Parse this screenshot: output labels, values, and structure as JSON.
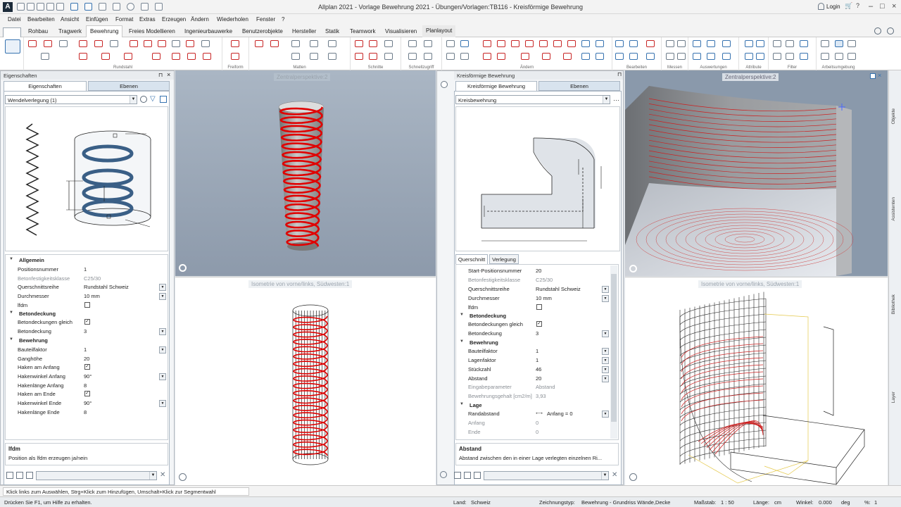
{
  "app": {
    "title": "Allplan 2021 - Vorlage Bewehrung 2021 - Übungen/Vorlagen:TB116 - Kreisförmige Bewehrung",
    "login": "Login",
    "logo": "A"
  },
  "menu": [
    "Datei",
    "Bearbeiten",
    "Ansicht",
    "Einfügen",
    "Format",
    "Extras",
    "Erzeugen",
    "Ändern",
    "Wiederholen",
    "Fenster",
    "?"
  ],
  "ribbon_tabs": [
    "Rohbau",
    "Tragwerk",
    "Bewehrung",
    "Freies Modellieren",
    "Ingenieurbauwerke",
    "Benutzerobjekte",
    "Hersteller",
    "Statik",
    "Teamwork",
    "Visualisieren",
    "Planlayout"
  ],
  "ribbon_groups": [
    "Rundstahl",
    "Freiform",
    "Matten",
    "Schnitte",
    "Schnellzugriff",
    "Ändern",
    "Bearbeiten",
    "Messen",
    "Auswertungen",
    "Attribute",
    "Filter",
    "Arbeitsumgebung"
  ],
  "left_panel": {
    "header": "Eigenschaften",
    "tabs": [
      "Eigenschaften",
      "Ebenen"
    ],
    "combo": "Wendelverlegung (1)",
    "sections": [
      {
        "title": "Allgemein",
        "rows": [
          {
            "label": "Positionsnummer",
            "value": "1"
          },
          {
            "label": "Betonfestigkeitsklasse",
            "value": "C25/30",
            "grey": true
          },
          {
            "label": "Querschnittsreihe",
            "value": "Rundstahl Schweiz",
            "dd": true
          },
          {
            "label": "Durchmesser",
            "value": "10 mm",
            "dd": true
          },
          {
            "label": "lfdm",
            "check": false
          }
        ]
      },
      {
        "title": "Betondeckung",
        "rows": [
          {
            "label": "Betondeckungen gleich",
            "check": true
          },
          {
            "label": "Betondeckung",
            "value": "3",
            "dd": true
          }
        ]
      },
      {
        "title": "Bewehrung",
        "rows": [
          {
            "label": "Bauteilfaktor",
            "value": "1",
            "dd": true
          },
          {
            "label": "Ganghöhe",
            "value": "20"
          },
          {
            "label": "Haken am Anfang",
            "check": true
          },
          {
            "label": "Hakenwinkel Anfang",
            "value": "90°",
            "dd": true
          },
          {
            "label": "Hakenlänge Anfang",
            "value": "8"
          },
          {
            "label": "Haken am Ende",
            "check": true
          },
          {
            "label": "Hakenwinkel Ende",
            "value": "90°",
            "dd": true
          },
          {
            "label": "Hakenlänge Ende",
            "value": "8"
          }
        ]
      }
    ],
    "help_title": "lfdm",
    "help_text": "Position als lfdm erzeugen ja/nein"
  },
  "mid_panel": {
    "header": "Kreisförmige Bewehrung",
    "tabs": [
      "Kreisförmige Bewehrung",
      "Ebenen"
    ],
    "combo": "Kreisbewehrung",
    "subtabs": [
      "Querschnitt",
      "Verlegung"
    ],
    "sections": [
      {
        "title": "",
        "rows": [
          {
            "label": "Start-Positionsnummer",
            "value": "20"
          },
          {
            "label": "Betonfestigkeitsklasse",
            "value": "C25/30",
            "grey": true
          },
          {
            "label": "Querschnittsreihe",
            "value": "Rundstahl Schweiz",
            "dd": true
          },
          {
            "label": "Durchmesser",
            "value": "10 mm",
            "dd": true
          },
          {
            "label": "lfdm",
            "check": false
          }
        ]
      },
      {
        "title": "Betondeckung",
        "rows": [
          {
            "label": "Betondeckungen gleich",
            "check": true
          },
          {
            "label": "Betondeckung",
            "value": "3",
            "dd": true
          }
        ]
      },
      {
        "title": "Bewehrung",
        "rows": [
          {
            "label": "Bauteilfaktor",
            "value": "1",
            "dd": true
          },
          {
            "label": "Lagenfaktor",
            "value": "1",
            "dd": true
          },
          {
            "label": "Stückzahl",
            "value": "46",
            "dd": true
          },
          {
            "label": "Abstand",
            "value": "20",
            "dd": true
          },
          {
            "label": "Eingabeparameter",
            "value": "Abstand",
            "grey": true
          },
          {
            "label": "Bewehrungsgehalt [cm2/m]",
            "value": "3,93",
            "grey": true
          }
        ]
      },
      {
        "title": "Lage",
        "rows": [
          {
            "label": "Randabstand",
            "value": "Anfang = 0",
            "dd": true
          },
          {
            "label": "Anfang",
            "value": "0",
            "grey": true
          },
          {
            "label": "Ende",
            "value": "0",
            "grey": true
          }
        ]
      }
    ],
    "help_title": "Abstand",
    "help_text": "Abstand zwischen den in einer Lage verlegten einzelnen Ri..."
  },
  "viewports": {
    "vp1": "Zentralperspektive:2",
    "vp2": "Isometrie von vorne/links, Südwesten:1",
    "vp3": "Zentralperspektive:2",
    "vp4": "Isometrie von vorne/links, Südwesten:1"
  },
  "sidebar": [
    "Objekte",
    "Assistenten",
    "Bibliothek",
    "Layer"
  ],
  "status": {
    "prompt": "Klick links zum Auswählen, Strg+Klick zum Hinzufügen, Umschalt+Klick zur Segmentwahl",
    "help": "Drücken Sie F1, um Hilfe zu erhalten.",
    "land_label": "Land:",
    "land": "Schweiz",
    "zeichnungstyp_label": "Zeichnungstyp:",
    "zeichnungstyp": "Bewehrung - Grundriss Wände,Decke",
    "massstab_label": "Maßstab:",
    "massstab": "1 : 50",
    "laenge_label": "Länge:",
    "laenge": "cm",
    "winkel_label": "Winkel:",
    "winkel": "0.000",
    "winkel_unit": "deg",
    "percent_label": "%:",
    "percent": "1"
  },
  "colors": {
    "accent": "#c82626",
    "panel_blue": "#d8e3ee",
    "viewport_blue": "#8a99ab"
  }
}
